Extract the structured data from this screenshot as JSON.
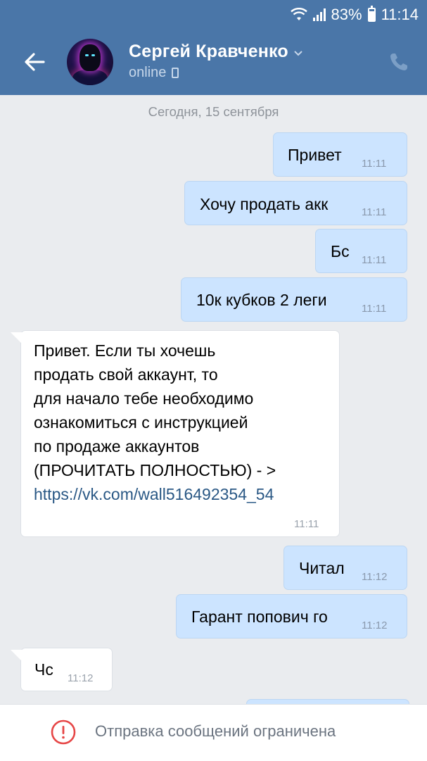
{
  "status_bar": {
    "battery": "83%",
    "time": "11:14",
    "signal_icon": "signal-bars-icon",
    "wifi_icon": "wifi-icon",
    "battery_icon": "battery-icon"
  },
  "header": {
    "name": "Сергей Кравченко",
    "status": "online",
    "back_icon": "arrow-left-icon",
    "call_icon": "phone-icon",
    "colors": {
      "bar": "#4a76a8",
      "status": "#c7d7ea"
    }
  },
  "chat": {
    "date_label": "Сегодня, 15 сентября",
    "messages": [
      {
        "direction": "out",
        "text": "Привет",
        "time": "11:11"
      },
      {
        "direction": "out",
        "text": "Хочу продать акк",
        "time": "11:11"
      },
      {
        "direction": "out",
        "text": "Бс",
        "time": "11:11"
      },
      {
        "direction": "out",
        "text": "10к кубков 2 леги",
        "time": "11:11"
      },
      {
        "direction": "in",
        "lines": [
          "Привет. Если ты хочешь",
          "продать свой аккаунт, то",
          "для начало тебе необходимо",
          "ознакомиться с инструкцией",
          "по продаже аккаунтов",
          "(ПРОЧИТАТЬ ПОЛНОСТЬЮ) - >"
        ],
        "link": "https://vk.com/wall516492354_54",
        "time": "11:11"
      },
      {
        "direction": "out",
        "text": "Читал",
        "time": "11:12"
      },
      {
        "direction": "out",
        "text": "Гарант попович го",
        "time": "11:12"
      },
      {
        "direction": "in",
        "text": "Чс",
        "time": "11:12"
      }
    ],
    "colors": {
      "outgoing": "#cce4ff",
      "incoming": "#ffffff",
      "link": "#2a5885",
      "background": "#eaecef"
    }
  },
  "footer": {
    "notice": "Отправка сообщений ограничена",
    "icon": "exclamation-circle-icon",
    "icon_color": "#e64646"
  }
}
